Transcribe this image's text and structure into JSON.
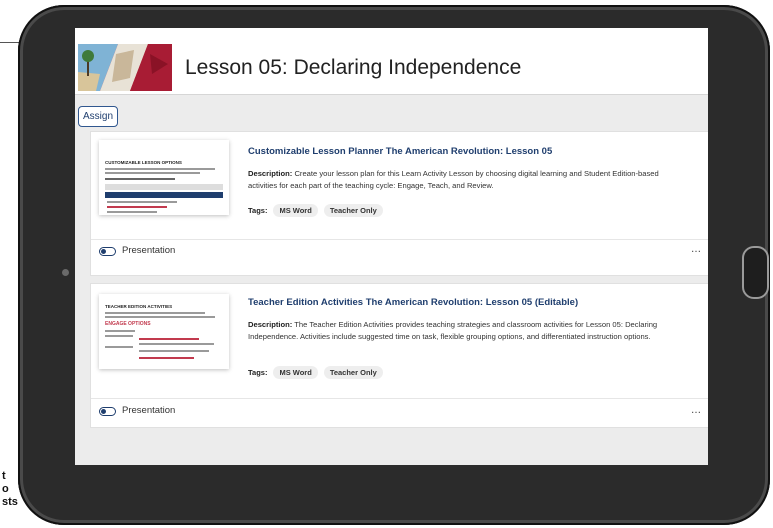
{
  "page_edge": {
    "lines": [
      "t",
      "o",
      "sts"
    ]
  },
  "lesson": {
    "title": "Lesson 05: Declaring Independence"
  },
  "toolbar": {
    "assign_label": "Assign"
  },
  "cards": [
    {
      "title": "Customizable Lesson Planner The American Revolution: Lesson 05",
      "description_label": "Description:",
      "description": "Create your lesson plan for this Learn Activity Lesson by choosing digital learning and Student Edition-based activities for each part of the teaching cycle: Engage, Teach, and Review.",
      "tags_label": "Tags:",
      "tags": [
        "MS Word",
        "Teacher Only"
      ],
      "toggle_label": "Presentation",
      "more": "…",
      "thumb_heading": "CUSTOMIZABLE LESSON OPTIONS"
    },
    {
      "title": "Teacher Edition Activities The American Revolution: Lesson 05 (Editable)",
      "description_label": "Description:",
      "description": "The Teacher Edition Activities provides teaching strategies and classroom activities for Lesson 05: Declaring Independence. Activities include suggested time on task, flexible grouping options, and differentiated instruction options.",
      "tags_label": "Tags:",
      "tags": [
        "MS Word",
        "Teacher Only"
      ],
      "toggle_label": "Presentation",
      "more": "…",
      "thumb_heading": "TEACHER EDITION ACTIVITIES",
      "thumb_subheading": "ENGAGE OPTIONS"
    }
  ],
  "colors": {
    "accent": "#1f3e6e",
    "screen_bg": "#ececec",
    "bezel": "#2b2b2b"
  },
  "icons": {
    "toggle": "toggle-switch-icon",
    "more": "more-options-icon"
  }
}
